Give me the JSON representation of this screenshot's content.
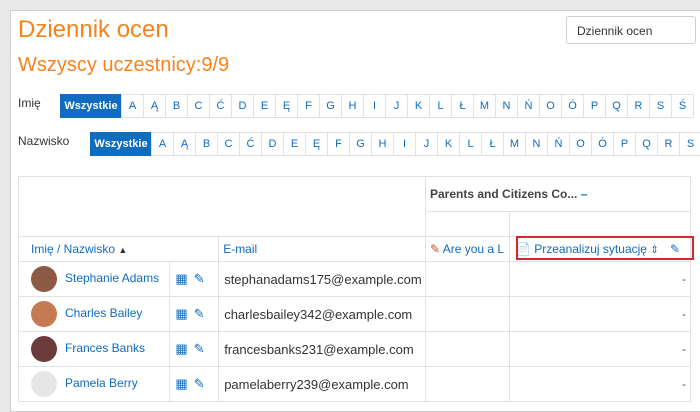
{
  "page": {
    "title": "Dziennik ocen",
    "participants": "Wszyscy uczestnicy:9/9",
    "view_select": "Dziennik ocen"
  },
  "filters": {
    "first_name_label": "Imię",
    "last_name_label": "Nazwisko",
    "all_label": "Wszystkie",
    "first_letters": [
      "A",
      "Ą",
      "B",
      "C",
      "Ć",
      "D",
      "E",
      "Ę",
      "F",
      "G",
      "H",
      "I",
      "J",
      "K",
      "L",
      "Ł",
      "M",
      "N",
      "Ń",
      "O",
      "Ó",
      "P",
      "Q",
      "R",
      "S",
      "Ś"
    ],
    "last_letters": [
      "A",
      "Ą",
      "B",
      "C",
      "Ć",
      "D",
      "E",
      "Ę",
      "F",
      "G",
      "H",
      "I",
      "J",
      "K",
      "L",
      "Ł",
      "M",
      "N",
      "Ń",
      "O",
      "Ó",
      "P",
      "Q",
      "R",
      "S"
    ]
  },
  "table": {
    "category_header": "Parents and Citizens Co...",
    "col_name": "Imię / Nazwisko",
    "col_email": "E-mail",
    "col_item1": "Are you a L",
    "col_item2": "Przeanalizuj sytuację",
    "rows": [
      {
        "name": "Stephanie Adams",
        "email": "stephanadams175@example.com",
        "grade": "-",
        "avatar_color": "#8a5a44"
      },
      {
        "name": "Charles Bailey",
        "email": "charlesbailey342@example.com",
        "grade": "-",
        "avatar_color": "#c47a52"
      },
      {
        "name": "Frances Banks",
        "email": "francesbanks231@example.com",
        "grade": "-",
        "avatar_color": "#6b3a3a"
      },
      {
        "name": "Pamela Berry",
        "email": "pamelaberry239@example.com",
        "grade": "-",
        "avatar_color": "#e6e6e6"
      }
    ]
  }
}
